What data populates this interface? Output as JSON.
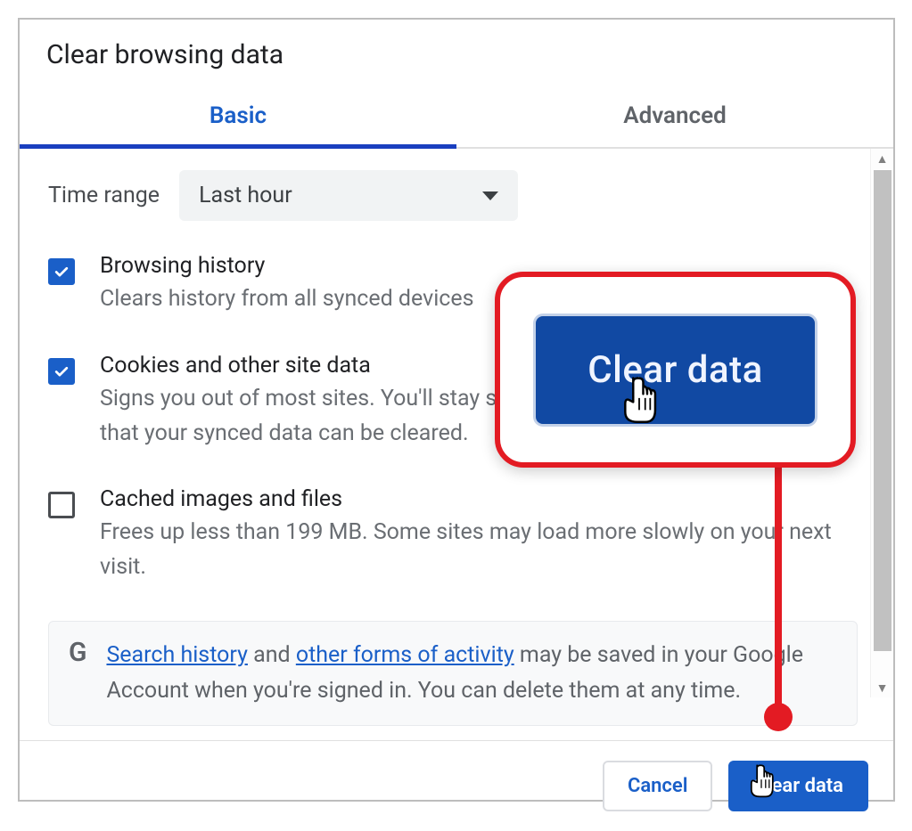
{
  "dialog": {
    "title": "Clear browsing data",
    "tabs": [
      {
        "label": "Basic",
        "active": true
      },
      {
        "label": "Advanced",
        "active": false
      }
    ],
    "time_range": {
      "label": "Time range",
      "value": "Last hour"
    },
    "options": [
      {
        "checked": true,
        "title": "Browsing history",
        "desc": "Clears history from all synced devices"
      },
      {
        "checked": true,
        "title": "Cookies and other site data",
        "desc": "Signs you out of most sites. You'll stay signed in to your Google Account so that your synced data can be cleared."
      },
      {
        "checked": false,
        "title": "Cached images and files",
        "desc": "Frees up less than 199 MB. Some sites may load more slowly on your next visit."
      }
    ],
    "info": {
      "link1": "Search history",
      "mid1": " and ",
      "link2": "other forms of activity",
      "rest": " may be saved in your Google Account when you're signed in. You can delete them at any time."
    },
    "footer": {
      "cancel": "Cancel",
      "clear": "Clear data"
    },
    "callout_label": "Clear data"
  }
}
